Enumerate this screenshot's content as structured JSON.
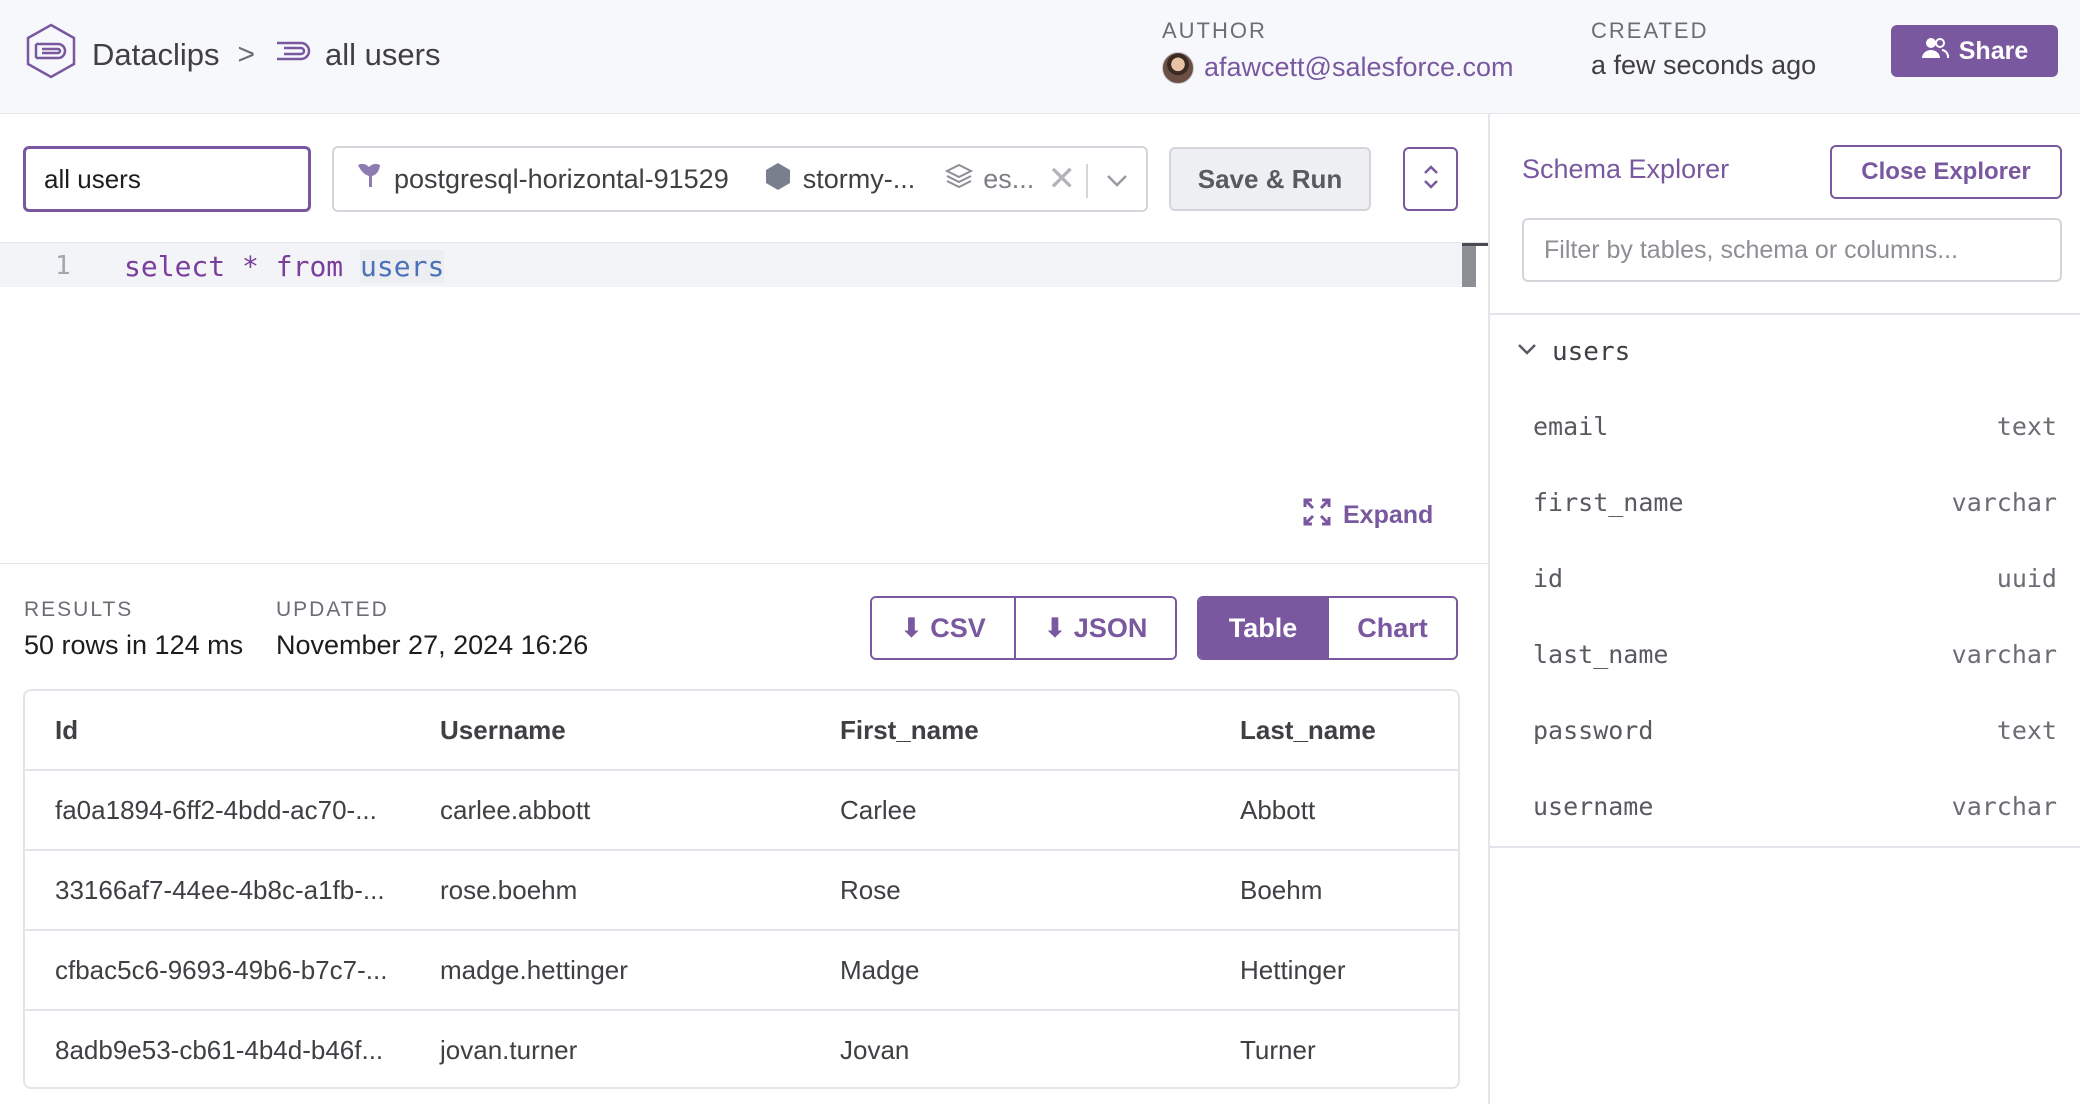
{
  "header": {
    "app_name": "Dataclips",
    "breadcrumb_sep": ">",
    "clip_name": "all users",
    "author_label": "AUTHOR",
    "author": "afawcett@salesforce.com",
    "created_label": "CREATED",
    "created": "a few seconds ago",
    "share_label": "Share"
  },
  "toolbar": {
    "name_value": "all users",
    "db_name": "postgresql-horizontal-91529",
    "app_name": "stormy-...",
    "space_name": "es...",
    "save_run_label": "Save & Run"
  },
  "editor": {
    "line_number": "1",
    "tokens": {
      "select": "select",
      "star": "*",
      "from": "from",
      "table": "users"
    },
    "expand_label": "Expand"
  },
  "results": {
    "results_label": "RESULTS",
    "results_value": "50 rows in 124 ms",
    "updated_label": "UPDATED",
    "updated_value": "November 27, 2024 16:26",
    "csv_label": "⬇ CSV",
    "json_label": "⬇ JSON",
    "table_label": "Table",
    "chart_label": "Chart",
    "active_view": "Table",
    "columns": [
      "Id",
      "Username",
      "First_name",
      "Last_name"
    ],
    "rows": [
      [
        "fa0a1894-6ff2-4bdd-ac70-...",
        "carlee.abbott",
        "Carlee",
        "Abbott"
      ],
      [
        "33166af7-44ee-4b8c-a1fb-...",
        "rose.boehm",
        "Rose",
        "Boehm"
      ],
      [
        "cfbac5c6-9693-49b6-b7c7-...",
        "madge.hettinger",
        "Madge",
        "Hettinger"
      ],
      [
        "8adb9e53-cb61-4b4d-b46f...",
        "jovan.turner",
        "Jovan",
        "Turner"
      ]
    ]
  },
  "schema": {
    "title": "Schema Explorer",
    "close_label": "Close Explorer",
    "filter_placeholder": "Filter by tables, schema or columns...",
    "table_name": "users",
    "columns": [
      {
        "name": "email",
        "type": "text"
      },
      {
        "name": "first_name",
        "type": "varchar"
      },
      {
        "name": "id",
        "type": "uuid"
      },
      {
        "name": "last_name",
        "type": "varchar"
      },
      {
        "name": "password",
        "type": "text"
      },
      {
        "name": "username",
        "type": "varchar"
      }
    ]
  },
  "colors": {
    "accent": "#79589f",
    "header_bg": "#f7f8fb",
    "border": "#e3e5ea"
  }
}
